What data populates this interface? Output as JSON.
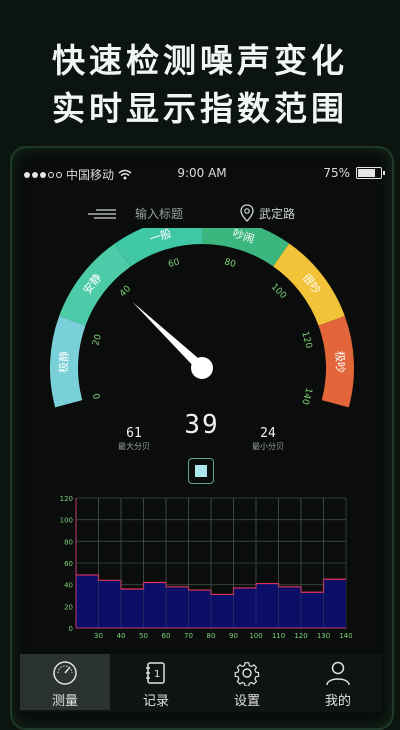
{
  "promo": {
    "line1": "快速检测噪声变化",
    "line2": "实时显示指数范围"
  },
  "status": {
    "carrier": "中国移动",
    "time": "9:00 AM",
    "battery": "75%",
    "battery_level": 0.75
  },
  "titlebar": {
    "title_placeholder": "输入标题",
    "location": "武定路"
  },
  "gauge": {
    "segments": [
      {
        "label": "极静",
        "color": "#79d0d8"
      },
      {
        "label": "安静",
        "color": "#4ccba8"
      },
      {
        "label": "一般",
        "color": "#3fc7a6"
      },
      {
        "label": "吵闹",
        "color": "#3ab67e"
      },
      {
        "label": "很吵",
        "color": "#f2c239"
      },
      {
        "label": "极吵",
        "color": "#e3663a"
      }
    ],
    "ticks": [
      "0",
      "20",
      "40",
      "60",
      "80",
      "100",
      "120",
      "140"
    ],
    "min": 0,
    "max": 140,
    "needle_value": 39
  },
  "readings": {
    "current": "39",
    "max_value": "61",
    "max_label": "最大分贝",
    "min_value": "24",
    "min_label": "最小分贝"
  },
  "chart_data": {
    "type": "area",
    "y_ticks": [
      "120",
      "100",
      "80",
      "60",
      "40",
      "20",
      "0"
    ],
    "x_ticks": [
      "30",
      "40",
      "50",
      "60",
      "70",
      "80",
      "90",
      "100",
      "110",
      "120",
      "130",
      "140"
    ],
    "ylim": [
      0,
      120
    ],
    "values": [
      49,
      49,
      44,
      44,
      36,
      36,
      42,
      42,
      38,
      38,
      35,
      35,
      31,
      31,
      37,
      37,
      41,
      41,
      38,
      38,
      33,
      33,
      45,
      45
    ],
    "line_color": "#e0325a",
    "fill_color": "#0b0f6b",
    "grid": true
  },
  "tabs": [
    {
      "label": "测量",
      "icon": "gauge-icon",
      "active": true
    },
    {
      "label": "记录",
      "icon": "record-book-icon",
      "active": false
    },
    {
      "label": "设置",
      "icon": "gear-icon",
      "active": false
    },
    {
      "label": "我的",
      "icon": "person-icon",
      "active": false
    }
  ]
}
